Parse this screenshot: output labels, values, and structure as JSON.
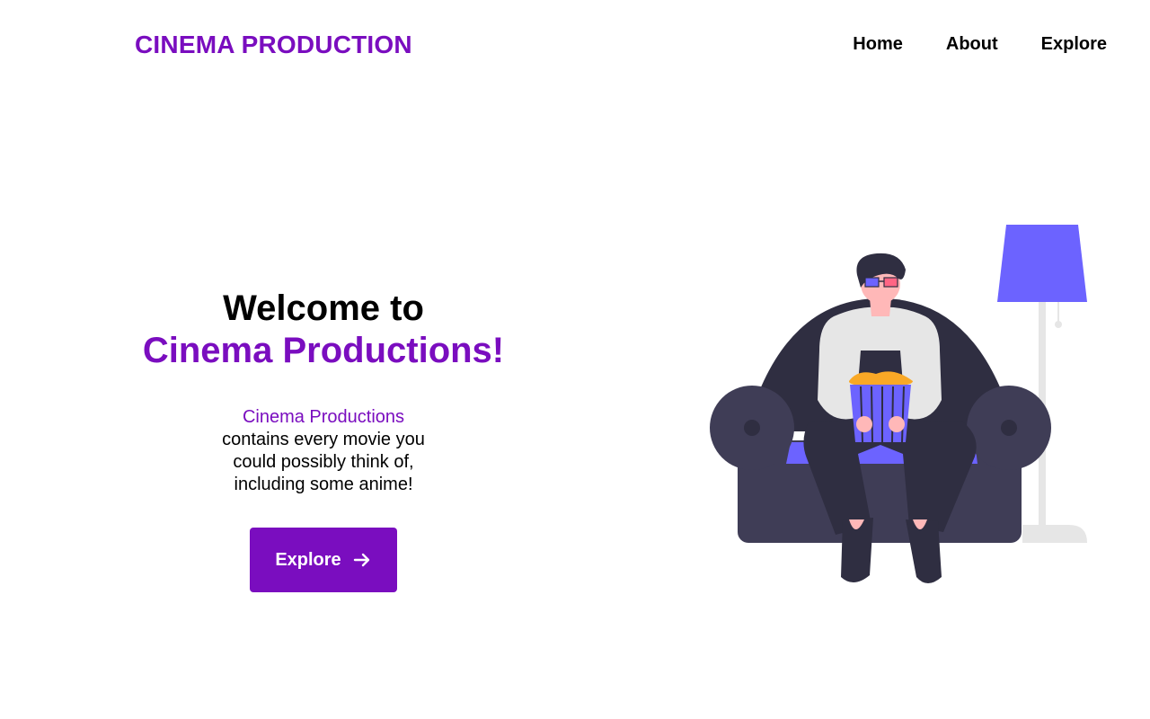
{
  "navbar": {
    "brand": "CINEMA PRODUCTION",
    "links": [
      {
        "label": "Home"
      },
      {
        "label": "About"
      },
      {
        "label": "Explore"
      }
    ]
  },
  "hero": {
    "title_line1": "Welcome to",
    "title_line2": "Cinema Productions!",
    "desc_highlight": "Cinema Productions",
    "desc_body": "contains every movie you could possibly think of, including some anime!",
    "button_label": "Explore",
    "button_icon": "arrow-right-icon"
  },
  "illustration": {
    "subject": "person-on-couch-with-popcorn-illustration"
  },
  "colors": {
    "accent": "#7a0dbf",
    "illustration_purple": "#6c63ff",
    "couch_dark": "#3f3d56",
    "text": "#000000"
  }
}
